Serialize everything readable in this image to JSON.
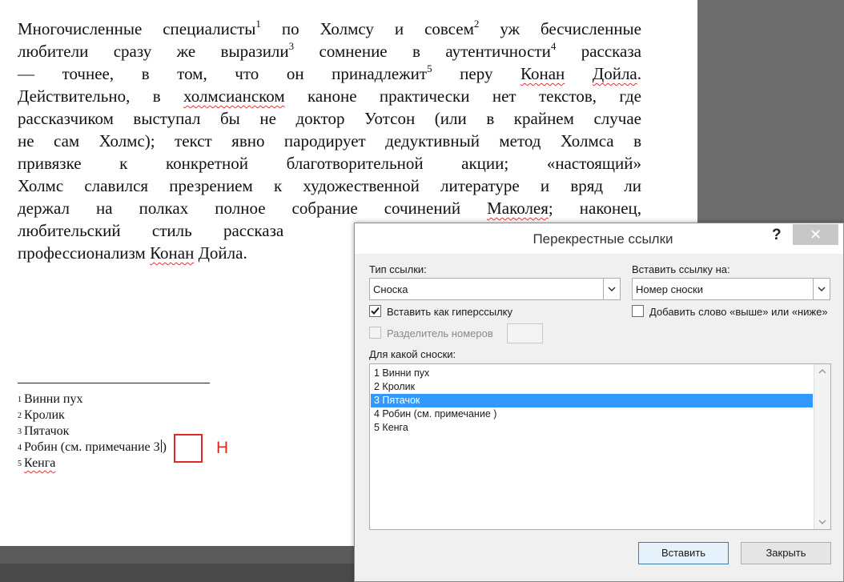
{
  "document": {
    "lines": [
      [
        "Многочисленные специалисты",
        "1",
        " по Холмсу и совсем",
        "2",
        " уж бесчисленные"
      ],
      [
        "любители сразу же выразили",
        "3",
        " сомнение в аутентичности",
        "4",
        " рассказа"
      ],
      [
        "— точнее, в том, что он принадлежит",
        "5",
        " перу "
      ],
      [
        "Действительно, в ",
        "холмсианском",
        " каноне практически нет текстов, где"
      ],
      [
        "рассказчиком выступал бы не доктор Уотсон (или в крайнем случае"
      ],
      [
        "не сам Холмс); текст явно пародирует дедуктивный метод Холмса в"
      ],
      [
        "привязке к конкретной благотворительной акции; «настоящий»"
      ],
      [
        "Холмс славился презрением к художественной литературе и вряд ли"
      ],
      [
        "держал на полках полное собрание сочинений ",
        "Маколея",
        "; наконец,"
      ],
      [
        "любительский стиль рассказа"
      ],
      [
        "профессионализм ",
        "Конан",
        " Дойла."
      ]
    ],
    "line3_tail": [
      "Конан",
      " ",
      "Дойла",
      "."
    ],
    "footnotes": [
      {
        "num": "1",
        "text": "Винни пух"
      },
      {
        "num": "2",
        "text": "Кролик"
      },
      {
        "num": "3",
        "text": "Пятачок"
      },
      {
        "num": "4",
        "text": "Робин (см. примечание ",
        "ref": "3",
        "after": ")"
      },
      {
        "num": "5",
        "text": "Кенга"
      }
    ],
    "annotation_letter": "Н",
    "annotation_color": "#e02a2a"
  },
  "dialog": {
    "title": "Перекрестные ссылки",
    "help": "?",
    "close": "✕",
    "ref_type_label": "Тип ссылки:",
    "ref_type_value": "Сноска",
    "insert_ref_label": "Вставить ссылку на:",
    "insert_ref_value": "Номер сноски",
    "hyperlink_label": "Вставить как гиперссылку",
    "hyperlink_checked": true,
    "above_below_label": "Добавить слово «выше» или «ниже»",
    "above_below_checked": false,
    "separator_label": "Разделитель номеров",
    "list_label": "Для какой сноски:",
    "items": [
      "1  Винни пух",
      "2  Кролик",
      "3  Пятачок",
      "4  Робин (см. примечание  )",
      "5  Кенга"
    ],
    "selected_index": 2,
    "insert_button": "Вставить",
    "close_button": "Закрыть"
  }
}
